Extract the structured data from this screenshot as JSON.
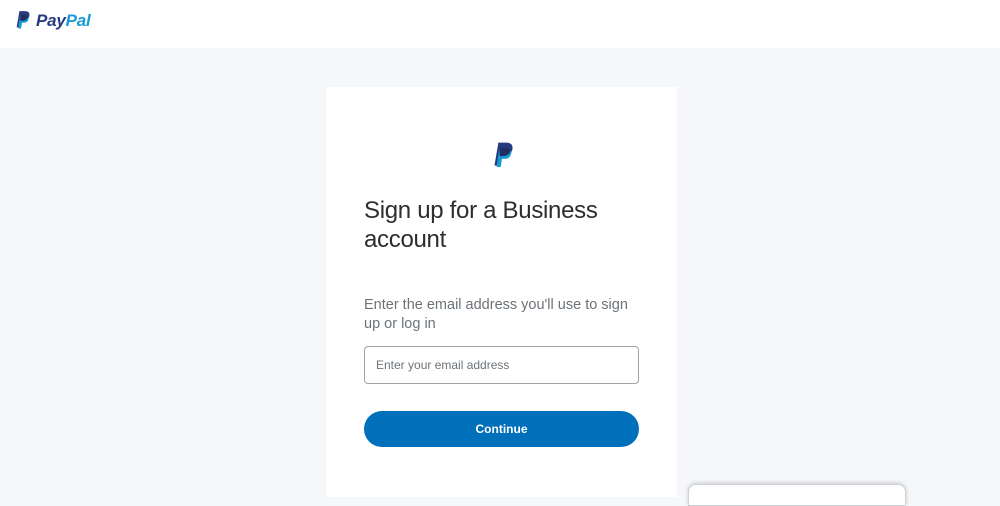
{
  "header": {
    "brand": {
      "word_part1": "Pay",
      "word_part2": "Pal",
      "icon": "paypal-logo-icon",
      "colors": {
        "dark_blue": "#253b80",
        "light_blue": "#179bd7"
      }
    }
  },
  "signup": {
    "logo_icon": "paypal-monogram-icon",
    "title": "Sign up for a Business account",
    "subtitle": "Enter the email address you'll use to sign up or log in",
    "email": {
      "value": "",
      "placeholder": "Enter your email address"
    },
    "continue_label": "Continue"
  },
  "theme": {
    "page_background": "#f5f7fa",
    "card_background": "#ffffff",
    "button_color": "#0070ba",
    "title_color": "#2c2e2f",
    "muted_text_color": "#6c7378"
  }
}
